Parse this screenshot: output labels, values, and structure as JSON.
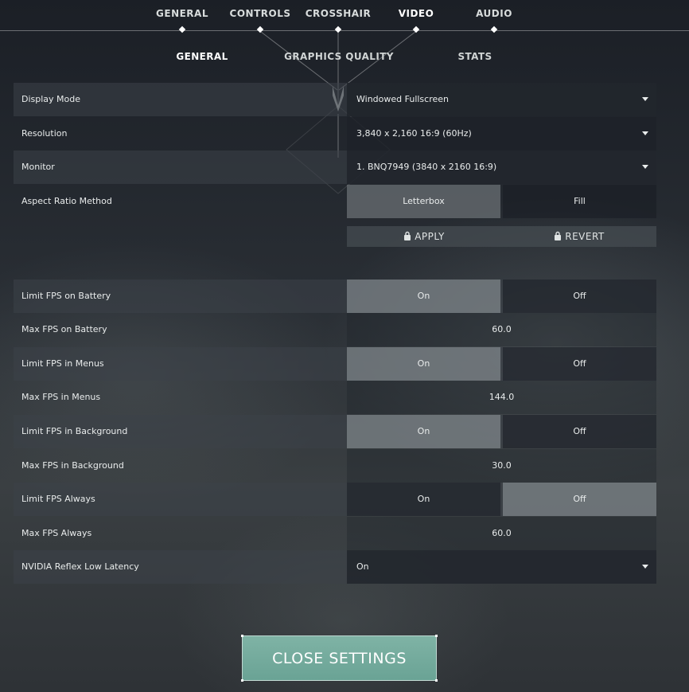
{
  "top_tabs": [
    {
      "label": "GENERAL"
    },
    {
      "label": "CONTROLS"
    },
    {
      "label": "CROSSHAIR"
    },
    {
      "label": "VIDEO"
    },
    {
      "label": "AUDIO"
    }
  ],
  "sub_tabs": [
    {
      "label": "GENERAL"
    },
    {
      "label": "GRAPHICS QUALITY"
    },
    {
      "label": "STATS"
    }
  ],
  "settings": {
    "display_mode": {
      "label": "Display Mode",
      "value": "Windowed Fullscreen"
    },
    "resolution": {
      "label": "Resolution",
      "value": "3,840 x 2,160 16:9 (60Hz)"
    },
    "monitor": {
      "label": "Monitor",
      "value": "1. BNQ7949 (3840 x  2160 16:9)"
    },
    "aspect_ratio": {
      "label": "Aspect Ratio Method",
      "options": [
        "Letterbox",
        "Fill"
      ],
      "selected": "Letterbox"
    },
    "limit_fps_battery": {
      "label": "Limit FPS on Battery",
      "options": [
        "On",
        "Off"
      ],
      "selected": "On"
    },
    "max_fps_battery": {
      "label": "Max FPS on Battery",
      "value": "60.0"
    },
    "limit_fps_menus": {
      "label": "Limit FPS in Menus",
      "options": [
        "On",
        "Off"
      ],
      "selected": "On"
    },
    "max_fps_menus": {
      "label": "Max FPS in Menus",
      "value": "144.0"
    },
    "limit_fps_background": {
      "label": "Limit FPS in Background",
      "options": [
        "On",
        "Off"
      ],
      "selected": "On"
    },
    "max_fps_background": {
      "label": "Max FPS in Background",
      "value": "30.0"
    },
    "limit_fps_always": {
      "label": "Limit FPS Always",
      "options": [
        "On",
        "Off"
      ],
      "selected": "Off"
    },
    "max_fps_always": {
      "label": "Max FPS Always",
      "value": "60.0"
    },
    "nvidia_reflex": {
      "label": "NVIDIA Reflex Low Latency",
      "value": "On"
    }
  },
  "actions": {
    "apply": "APPLY",
    "revert": "REVERT",
    "close": "CLOSE SETTINGS"
  },
  "colors": {
    "accent": "#6aa395"
  },
  "icons": {
    "apply": "lock-icon",
    "revert": "lock-icon"
  }
}
